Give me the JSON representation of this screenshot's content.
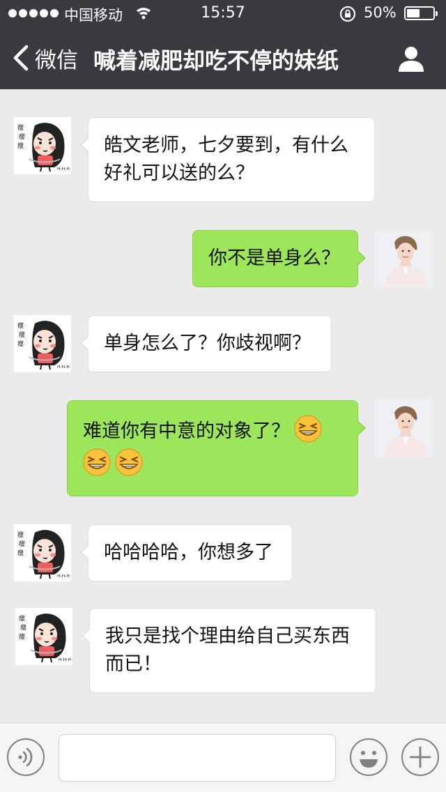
{
  "status_bar": {
    "carrier": "中国移动",
    "time": "15:57",
    "battery_percent": "50%",
    "battery_level": 0.5
  },
  "nav": {
    "back_label": "微信",
    "title": "喊着减肥却吃不停的妹纸",
    "back_icon": "chevron-left-icon",
    "profile_icon": "person-icon"
  },
  "messages": [
    {
      "side": "in",
      "text": "皓文老师，七夕要到，有什么好礼可以送的么？",
      "lines": [
        "皓文老师，七夕要到，有什么",
        "好礼可以送的么？"
      ]
    },
    {
      "side": "out",
      "text": "你不是单身么？"
    },
    {
      "side": "in",
      "text": "单身怎么了？你歧视啊？"
    },
    {
      "side": "out",
      "text": "难道你有中意的对象了？",
      "emoji": "grinning-squint-emoji",
      "emoji_count": 3
    },
    {
      "side": "in",
      "text": "哈哈哈哈，你想多了"
    },
    {
      "side": "in",
      "text": "我只是找个理由给自己买东西而已！",
      "lines": [
        "我只是找个理由给自己买东西",
        "而已！"
      ]
    }
  ],
  "input_bar": {
    "voice_icon": "voice-icon",
    "emoji_icon": "smiley-icon",
    "add_icon": "plus-icon",
    "placeholder": ""
  },
  "colors": {
    "nav_bg": "#393a3f",
    "chat_bg": "#ebebeb",
    "outgoing_bubble": "#9de55b",
    "incoming_bubble": "#ffffff"
  }
}
